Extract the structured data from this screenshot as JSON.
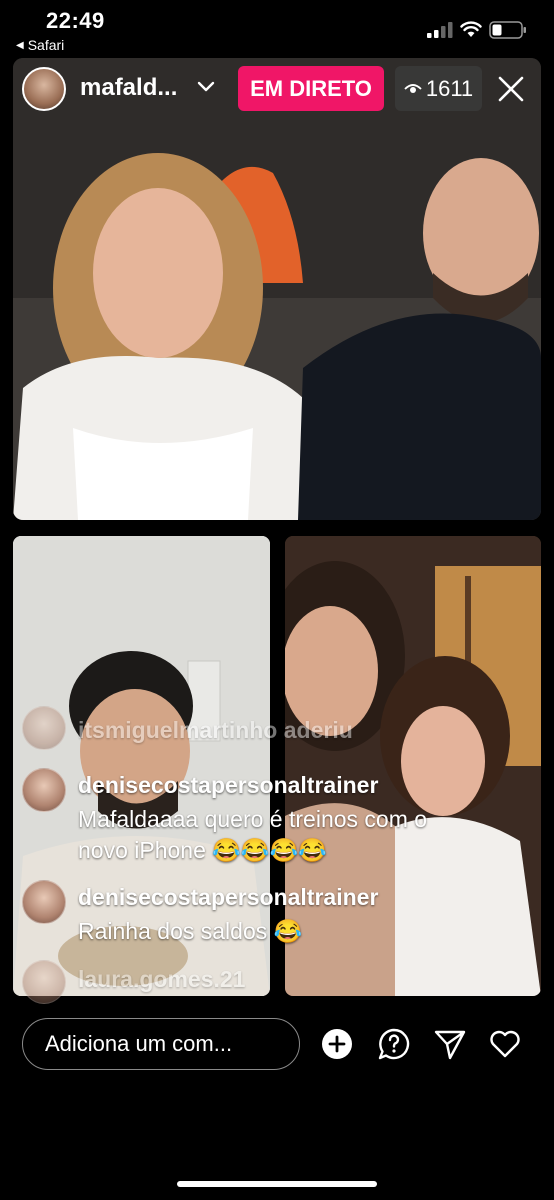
{
  "status_bar": {
    "time": "22:49",
    "back_app": "Safari"
  },
  "live": {
    "host_name": "mafald...",
    "badge": "EM DIRETO",
    "viewer_count": "1611"
  },
  "comments": [
    {
      "user": "itsmiguelmartinho aderiu",
      "text": ""
    },
    {
      "user": "denisecostapersonaltrainer",
      "text": "Mafaldaaaa quero é treinos com o novo iPhone 😂😂😂😂"
    },
    {
      "user": "denisecostapersonaltrainer",
      "text": "Rainha dos saldos 😂"
    },
    {
      "user": "laura.gomes.21",
      "text": ""
    }
  ],
  "composer": {
    "placeholder": "Adiciona um com..."
  },
  "colors": {
    "live_badge": "#f01667"
  },
  "icons": {
    "add": "plus-circle-icon",
    "question": "question-bubble-icon",
    "share": "send-paper-plane-icon",
    "like": "heart-icon"
  }
}
